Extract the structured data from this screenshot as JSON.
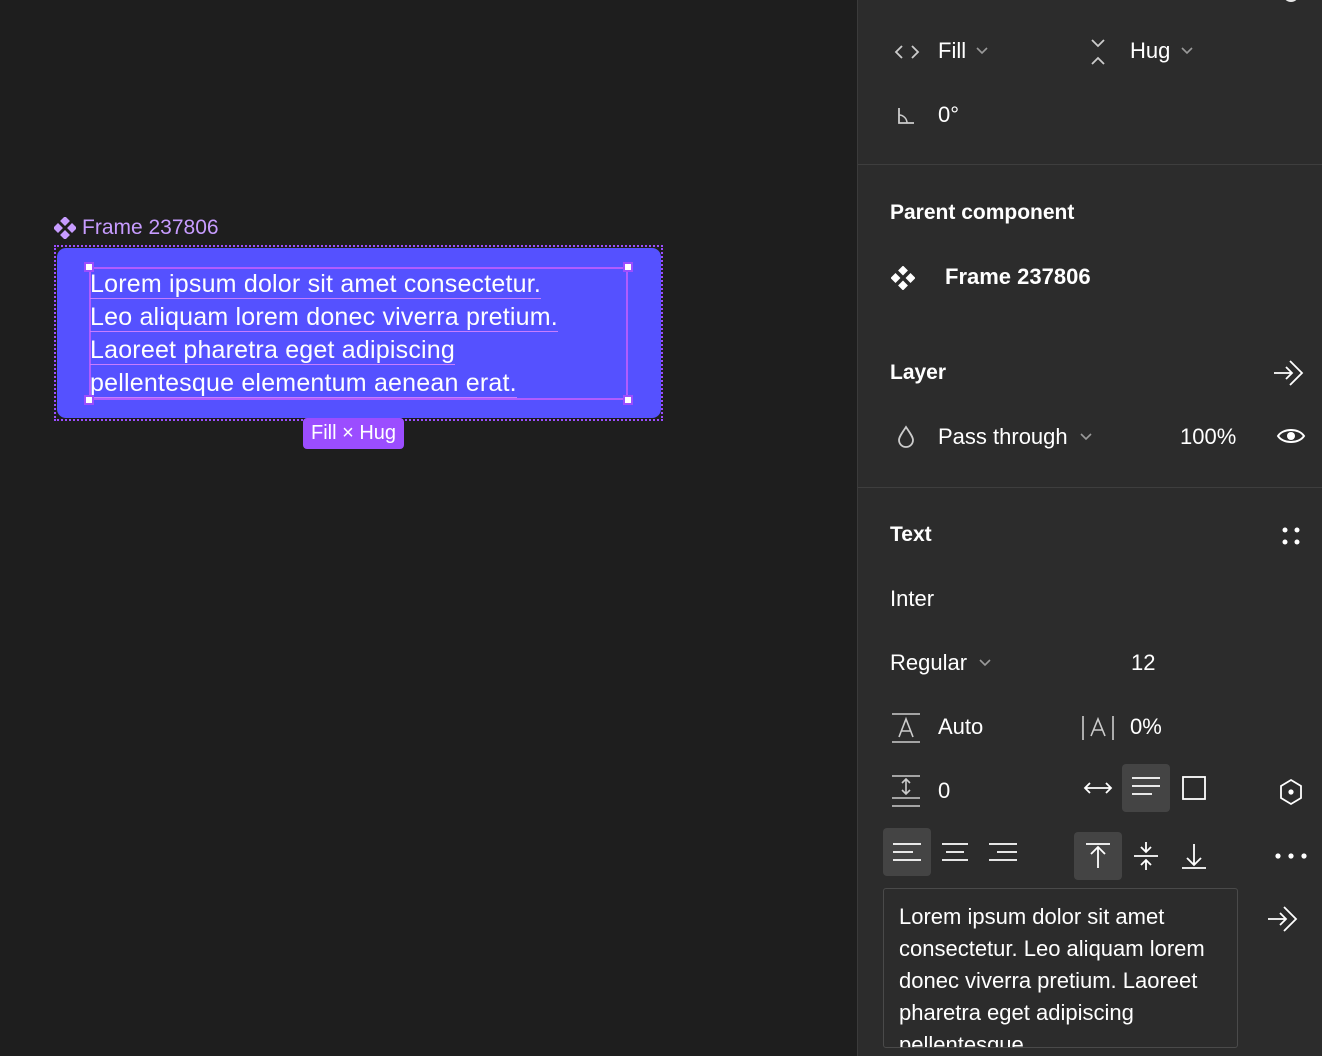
{
  "canvas": {
    "frame_label": "Frame 237806",
    "frame_text_lines": [
      "Lorem ipsum dolor sit amet consectetur.",
      "Leo aliquam lorem donec viverra pretium.",
      "Laoreet pharetra eget adipiscing",
      "pellentesque elementum aenean erat."
    ],
    "size_badge": "Fill × Hug",
    "frame_color": "#5551ff",
    "selection_color": "#9b4dff"
  },
  "panel": {
    "width_mode": "Fill",
    "height_mode": "Hug",
    "rotation": "0°",
    "parent_component": {
      "header": "Parent component",
      "name": "Frame 237806"
    },
    "layer": {
      "header": "Layer",
      "blend_mode": "Pass through",
      "opacity": "100%"
    },
    "text": {
      "header": "Text",
      "font_family": "Inter",
      "font_weight": "Regular",
      "font_size": "12",
      "line_height": "Auto",
      "letter_spacing": "0%",
      "paragraph_spacing": "0",
      "content": "Lorem ipsum dolor sit amet consectetur. Leo aliquam lorem donec viverra pretium. Laoreet pharetra eget adipiscing pellentesque"
    }
  }
}
